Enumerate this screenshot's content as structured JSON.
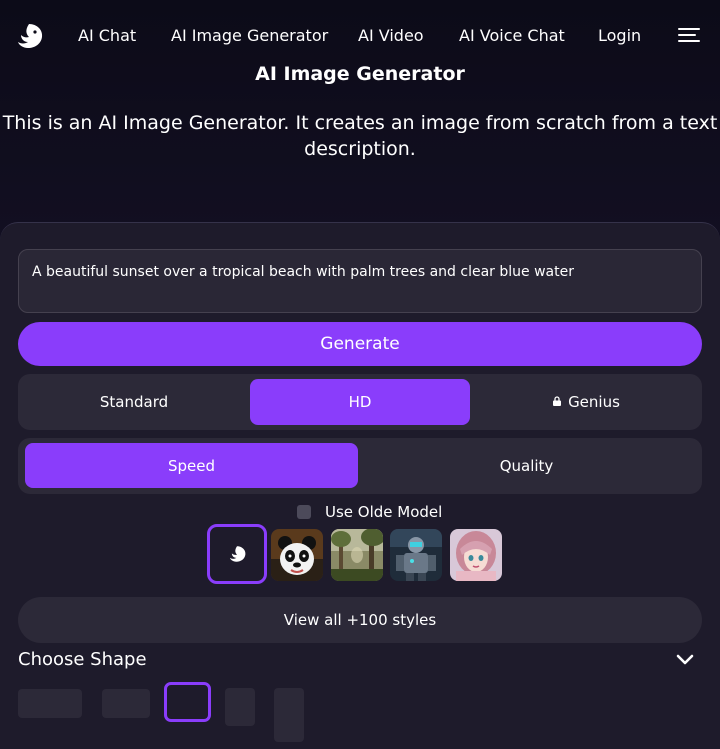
{
  "nav": {
    "logo_icon": "dolphin-logo-icon",
    "links": [
      "AI Chat",
      "AI Image Generator",
      "AI Video",
      "AI Voice Chat",
      "Login"
    ],
    "menu_icon": "hamburger-menu-icon"
  },
  "header": {
    "title": "AI Image Generator",
    "description": "This is an AI Image Generator. It creates an image from scratch from a text description."
  },
  "prompt": {
    "value": "A beautiful sunset over a tropical beach with palm trees and clear blue water"
  },
  "generate_label": "Generate",
  "resolution": {
    "options": [
      "Standard",
      "HD",
      "Genius"
    ],
    "selected": "HD",
    "locked": "Genius"
  },
  "mode": {
    "options": [
      "Speed",
      "Quality"
    ],
    "selected": "Speed"
  },
  "old_model": {
    "label": "Use Olde Model",
    "checked": false
  },
  "styles": {
    "thumbnails": [
      "default-logo-style",
      "panda-style",
      "forest-style",
      "robot-style",
      "anime-girl-style"
    ],
    "selected": "default-logo-style",
    "view_all_label": "View all +100 styles"
  },
  "shape": {
    "label": "Choose Shape",
    "options_count": 5,
    "selected_index": 2
  },
  "colors": {
    "accent": "#8a3dfb",
    "panel": "#1e1b2b",
    "control": "#2c2938"
  }
}
